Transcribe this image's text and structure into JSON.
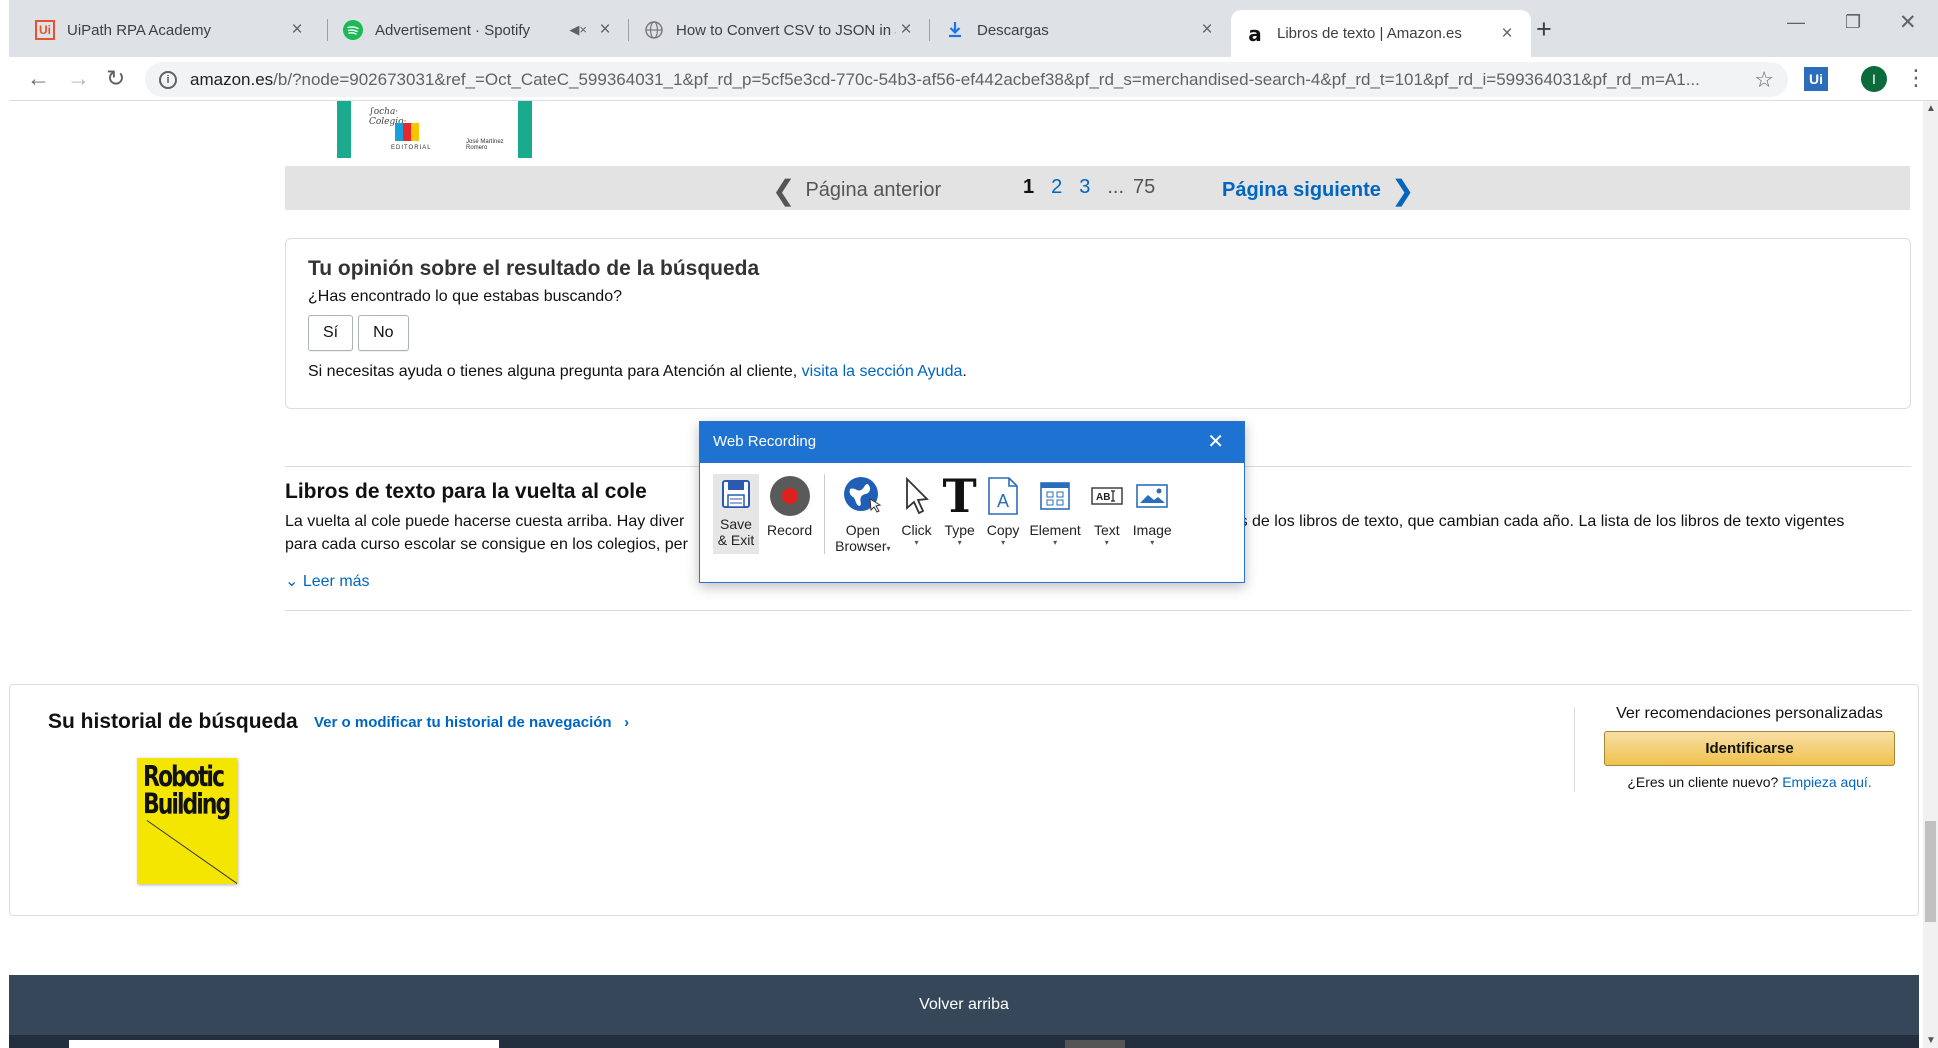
{
  "browser": {
    "tabs": [
      {
        "title": "UiPath RPA Academy",
        "favicon": "uipath-icon"
      },
      {
        "title": "Advertisement · Spotify",
        "favicon": "spotify-icon"
      },
      {
        "title": "How to Convert CSV to JSON in J",
        "favicon": "globe-icon"
      },
      {
        "title": "Descargas",
        "favicon": "download-icon"
      },
      {
        "title": "Libros de texto | Amazon.es",
        "favicon": "amazon-icon"
      }
    ],
    "url_host": "amazon.es",
    "url_path": "/b/?node=902673031&ref_=Oct_CateC_599364031_1&pf_rd_p=5cf5e3cd-770c-54b3-af56-ef442acbef38&pf_rd_s=merchandised-search-4&pf_rd_t=101&pf_rd_i=599364031&pf_rd_m=A1...",
    "extension_label": "Ui",
    "avatar_initial": "I"
  },
  "pagination": {
    "prev": "Página anterior",
    "pages": [
      "1",
      "2",
      "3"
    ],
    "ellipsis": "...",
    "last": "75",
    "next": "Página siguiente"
  },
  "feedback": {
    "title": "Tu opinión sobre el resultado de la búsqueda",
    "question": "¿Has encontrado lo que estabas buscando?",
    "yes": "Sí",
    "no": "No",
    "help_text": "Si necesitas ayuda o tienes alguna pregunta para Atención al cliente, ",
    "help_link": "visita la sección Ayuda",
    "help_end": "."
  },
  "seo": {
    "title": "Libros de texto para la vuelta al cole",
    "text_left": "La vuelta al cole puede hacerse cuesta arriba. Hay diver",
    "text_right": "más de los libros de texto, que cambian cada año. La lista de los libros de texto vigentes",
    "text_line2": "para cada curso escolar se consigue en los colegios, per",
    "more": "Leer más"
  },
  "history": {
    "title": "Su historial de búsqueda",
    "link": "Ver o modificar tu historial de navegación",
    "link_arrow": "›",
    "book_title": "Robotic Building",
    "rec_title": "Ver recomendaciones personalizadas",
    "signin": "Identificarse",
    "new_customer": "¿Eres un cliente nuevo? ",
    "start_here": "Empieza aquí."
  },
  "footer": {
    "back_to_top": "Volver arriba"
  },
  "recorder": {
    "title": "Web Recording",
    "tools": [
      {
        "name": "save",
        "line1": "Save",
        "line2": "& Exit"
      },
      {
        "name": "record",
        "line1": "Record",
        "line2": ""
      },
      {
        "name": "open-browser",
        "line1": "Open",
        "line2": "Browser"
      },
      {
        "name": "click",
        "line1": "Click",
        "line2": ""
      },
      {
        "name": "type",
        "line1": "Type",
        "line2": ""
      },
      {
        "name": "copy",
        "line1": "Copy",
        "line2": ""
      },
      {
        "name": "element",
        "line1": "Element",
        "line2": ""
      },
      {
        "name": "text",
        "line1": "Text",
        "line2": ""
      },
      {
        "name": "image",
        "line1": "Image",
        "line2": ""
      }
    ]
  },
  "colors": {
    "amazon_link": "#0066c0",
    "recorder_blue": "#1e73d2",
    "footer_bg": "#37475a",
    "signin_gold": "#f0c14b"
  }
}
